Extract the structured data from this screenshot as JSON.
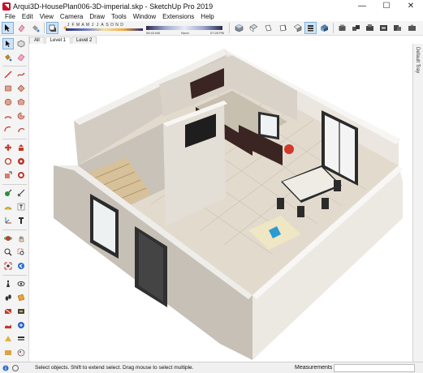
{
  "window": {
    "title": "Arqui3D-HousePlan006-3D-imperial.skp - SketchUp Pro 2019",
    "minimize": "—",
    "maximize": "☐",
    "close": "✕"
  },
  "menu": [
    "File",
    "Edit",
    "View",
    "Camera",
    "Draw",
    "Tools",
    "Window",
    "Extensions",
    "Help"
  ],
  "shadows": {
    "months": [
      "J",
      "F",
      "M",
      "A",
      "M",
      "J",
      "J",
      "A",
      "S",
      "O",
      "N",
      "D"
    ],
    "time_start": "06:43 AM",
    "time_mid": "Noon",
    "time_end": "07:28 PM"
  },
  "scene_tabs": [
    "All",
    "Level 1",
    "Level 2"
  ],
  "active_tab": "Level 1",
  "tray": {
    "label": "Default Tray"
  },
  "status": {
    "hint": "Select objects. Shift to extend select. Drag mouse to select multiple.",
    "measurements_label": "Measurements",
    "measurements_value": ""
  },
  "colors": {
    "accent": "#7eb2e0",
    "app_red": "#c8102e",
    "floor_tile": "#e6dfd2",
    "wall": "#d9d4cc",
    "wall_top": "#f2f0ec",
    "kitchen_cabinet": "#3b2522",
    "pillow": "#2a9ad0"
  },
  "icons": {
    "toolbar": [
      "select-icon",
      "eraser-icon",
      "shadows-toggle-icon",
      "iso-view-icon",
      "top-view-icon",
      "front-view-icon",
      "right-view-icon",
      "back-view-icon",
      "left-view-icon",
      "xray-style-icon",
      "wireframe-style-icon",
      "hidden-line-style-icon",
      "shaded-style-icon",
      "textured-style-icon",
      "monochrome-style-icon",
      "warehouse-icon",
      "extension-warehouse-icon",
      "layout-icon",
      "component-icon",
      "camera-icon"
    ],
    "palette": [
      "select-icon",
      "eraser-icon",
      "paint-bucket-icon",
      "line-icon",
      "rectangle-icon",
      "rotated-rectangle-icon",
      "circle-icon",
      "polygon-icon",
      "arc-icon",
      "pie-icon",
      "freehand-icon",
      "move-icon",
      "push-pull-icon",
      "rotate-icon",
      "follow-me-icon",
      "scale-icon",
      "offset-icon",
      "tape-measure-icon",
      "dimension-icon",
      "protractor-icon",
      "text-icon",
      "axes-icon",
      "3d-text-icon",
      "orbit-icon",
      "pan-icon",
      "zoom-icon",
      "zoom-window-icon",
      "zoom-extents-icon",
      "previous-view-icon",
      "position-camera-icon",
      "look-around-icon",
      "walk-icon",
      "section-plane-icon",
      "display-section-icon",
      "section-fill-icon",
      "sandbox-icon",
      "outliner-icon"
    ]
  }
}
